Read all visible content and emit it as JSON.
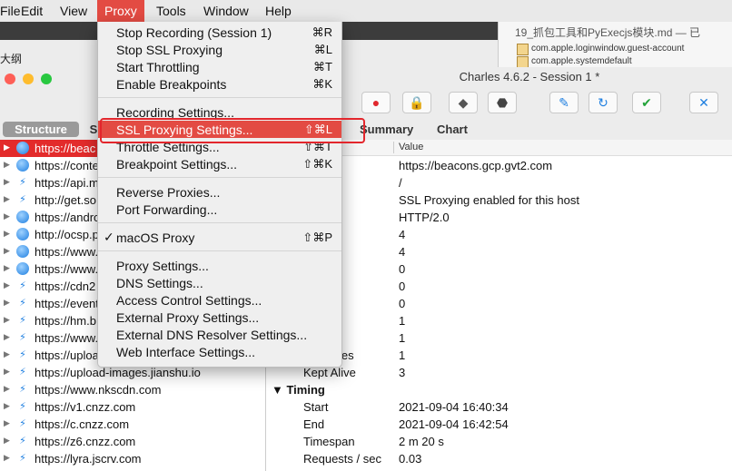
{
  "menubar": {
    "items": [
      "File",
      "Edit",
      "View",
      "Proxy",
      "Tools",
      "Window",
      "Help"
    ],
    "active_color": "#e34b43"
  },
  "background": {
    "note_title": "19_抓包工具和PyExecjs模块.md — 已",
    "note_items": [
      "com.apple.loginwindow.guest-account",
      "com.apple.systemdefault"
    ],
    "left_pane_label": "大纲"
  },
  "window": {
    "title": "Charles 4.6.2 - Session 1 *",
    "toolbar_icons": [
      "record-icon",
      "ssl-lock-icon",
      "turtle-icon",
      "stop-icon",
      "pen-icon",
      "refresh-icon",
      "check-icon",
      "tools-icon"
    ]
  },
  "left_tabs": {
    "structure": "Structure",
    "sequence": "S"
  },
  "right_tabs": {
    "summary": "Summary",
    "chart": "Chart"
  },
  "left_list": [
    {
      "url": "https://beac",
      "icon": "globe",
      "selected": true
    },
    {
      "url": "https://conte",
      "icon": "globe"
    },
    {
      "url": "https://api.m",
      "icon": "bolt"
    },
    {
      "url": "http://get.so",
      "icon": "bolt"
    },
    {
      "url": "https://andro",
      "icon": "globe"
    },
    {
      "url": "http://ocsp.p",
      "icon": "globe"
    },
    {
      "url": "https://www.",
      "icon": "globe"
    },
    {
      "url": "https://www.",
      "icon": "globe"
    },
    {
      "url": "https://cdn2",
      "icon": "bolt"
    },
    {
      "url": "https://event",
      "icon": "bolt"
    },
    {
      "url": "https://hm.b",
      "icon": "bolt"
    },
    {
      "url": "https://www.",
      "icon": "bolt"
    },
    {
      "url": "https://uploa",
      "icon": "bolt"
    },
    {
      "url": "https://upload-images.jianshu.io",
      "icon": "bolt"
    },
    {
      "url": "https://www.nkscdn.com",
      "icon": "bolt"
    },
    {
      "url": "https://v1.cnzz.com",
      "icon": "bolt"
    },
    {
      "url": "https://c.cnzz.com",
      "icon": "bolt"
    },
    {
      "url": "https://z6.cnzz.com",
      "icon": "bolt"
    },
    {
      "url": "https://lyra.jscrv.com",
      "icon": "bolt"
    }
  ],
  "detail": {
    "header_value": "Value",
    "rows": [
      {
        "k": "",
        "v": "https://beacons.gcp.gvt2.com"
      },
      {
        "k": "",
        "v": "/"
      },
      {
        "k": "",
        "v": "SSL Proxying enabled for this host"
      },
      {
        "k": "",
        "v": "HTTP/2.0"
      },
      {
        "k": "",
        "v": "4"
      },
      {
        "k": "ted",
        "v": "4"
      },
      {
        "k": "lete",
        "v": "0"
      },
      {
        "k": "",
        "v": "0"
      },
      {
        "k": "d",
        "v": "0"
      },
      {
        "k": "",
        "v": "1"
      },
      {
        "k": "ts",
        "v": "1"
      },
      {
        "k": "ndshakes",
        "v": "1"
      },
      {
        "k": "Kept Alive",
        "v": "3"
      },
      {
        "section": "Timing"
      },
      {
        "k": "Start",
        "v": "2021-09-04 16:40:34"
      },
      {
        "k": "End",
        "v": "2021-09-04 16:42:54"
      },
      {
        "k": "Timespan",
        "v": "2 m 20 s"
      },
      {
        "k": "Requests / sec",
        "v": "0.03"
      }
    ]
  },
  "proxy_menu": {
    "items": [
      {
        "label": "Stop Recording (Session 1)",
        "shortcut": "⌘R"
      },
      {
        "label": "Stop SSL Proxying",
        "shortcut": "⌘L"
      },
      {
        "label": "Start Throttling",
        "shortcut": "⌘T"
      },
      {
        "label": "Enable Breakpoints",
        "shortcut": "⌘K"
      },
      {
        "sep": true
      },
      {
        "label": "Recording Settings...",
        "shortcut": ""
      },
      {
        "label": "SSL Proxying Settings...",
        "shortcut": "⇧⌘L",
        "highlighted": true
      },
      {
        "label": "Throttle Settings...",
        "shortcut": "⇧⌘T"
      },
      {
        "label": "Breakpoint Settings...",
        "shortcut": "⇧⌘K"
      },
      {
        "sep": true
      },
      {
        "label": "Reverse Proxies...",
        "shortcut": ""
      },
      {
        "label": "Port Forwarding...",
        "shortcut": ""
      },
      {
        "sep": true
      },
      {
        "label": "macOS Proxy",
        "shortcut": "⇧⌘P",
        "checked": true
      },
      {
        "sep": true
      },
      {
        "label": "Proxy Settings...",
        "shortcut": ""
      },
      {
        "label": "DNS Settings...",
        "shortcut": ""
      },
      {
        "label": "Access Control Settings...",
        "shortcut": ""
      },
      {
        "label": "External Proxy Settings...",
        "shortcut": ""
      },
      {
        "label": "External DNS Resolver Settings...",
        "shortcut": ""
      },
      {
        "label": "Web Interface Settings...",
        "shortcut": ""
      }
    ]
  }
}
